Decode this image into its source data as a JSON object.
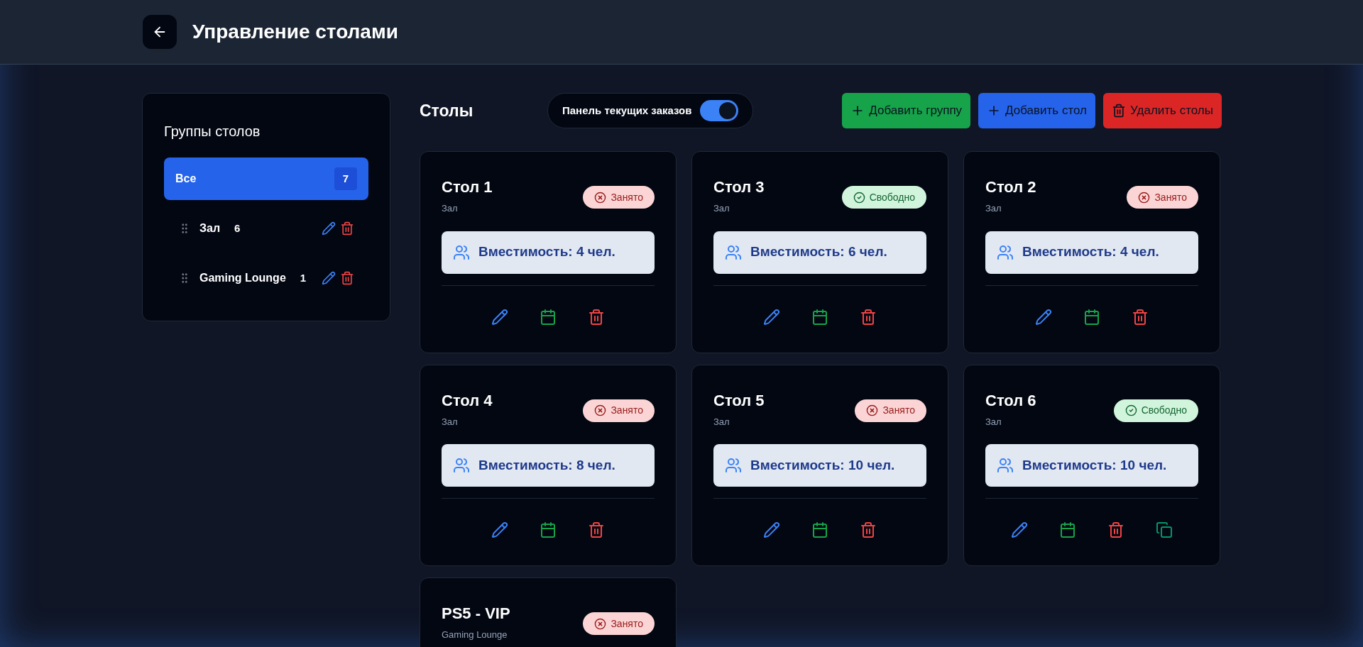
{
  "header": {
    "title": "Управление столами"
  },
  "sidebar": {
    "title": "Группы столов",
    "groups": [
      {
        "name": "Все",
        "count": "7",
        "selected": true,
        "editable": false
      },
      {
        "name": "Зал",
        "count": "6",
        "selected": false,
        "editable": true
      },
      {
        "name": "Gaming Lounge",
        "count": "1",
        "selected": false,
        "editable": true
      }
    ]
  },
  "toolbar": {
    "title": "Столы",
    "orders_panel": {
      "label": "Панель текущих заказов",
      "on": true
    },
    "buttons": [
      {
        "kind": "add",
        "label": "Добавить группу",
        "color": "#16a34a"
      },
      {
        "kind": "add",
        "label": "Добавить стол",
        "color": "#2563eb"
      },
      {
        "kind": "delete",
        "label": "Удалить столы",
        "color": "#dc2626"
      }
    ]
  },
  "tables": [
    {
      "name": "Стол 1",
      "group": "Зал",
      "status": {
        "kind": "busy",
        "label": "Занято"
      },
      "capacity": "Вместимость: 4 чел.",
      "copyable": false
    },
    {
      "name": "Стол 3",
      "group": "Зал",
      "status": {
        "kind": "free",
        "label": "Свободно"
      },
      "capacity": "Вместимость: 6 чел.",
      "copyable": false
    },
    {
      "name": "Стол 2",
      "group": "Зал",
      "status": {
        "kind": "busy",
        "label": "Занято"
      },
      "capacity": "Вместимость: 4 чел.",
      "copyable": false
    },
    {
      "name": "Стол 4",
      "group": "Зал",
      "status": {
        "kind": "busy",
        "label": "Занято"
      },
      "capacity": "Вместимость: 8 чел.",
      "copyable": false
    },
    {
      "name": "Стол 5",
      "group": "Зал",
      "status": {
        "kind": "busy",
        "label": "Занято"
      },
      "capacity": "Вместимость: 10 чел.",
      "copyable": false
    },
    {
      "name": "Стол 6",
      "group": "Зал",
      "status": {
        "kind": "free",
        "label": "Свободно"
      },
      "capacity": "Вместимость: 10 чел.",
      "copyable": true
    },
    {
      "name": "PS5 - VIP",
      "group": "Gaming Lounge",
      "status": {
        "kind": "busy",
        "label": "Занято"
      }
    }
  ]
}
